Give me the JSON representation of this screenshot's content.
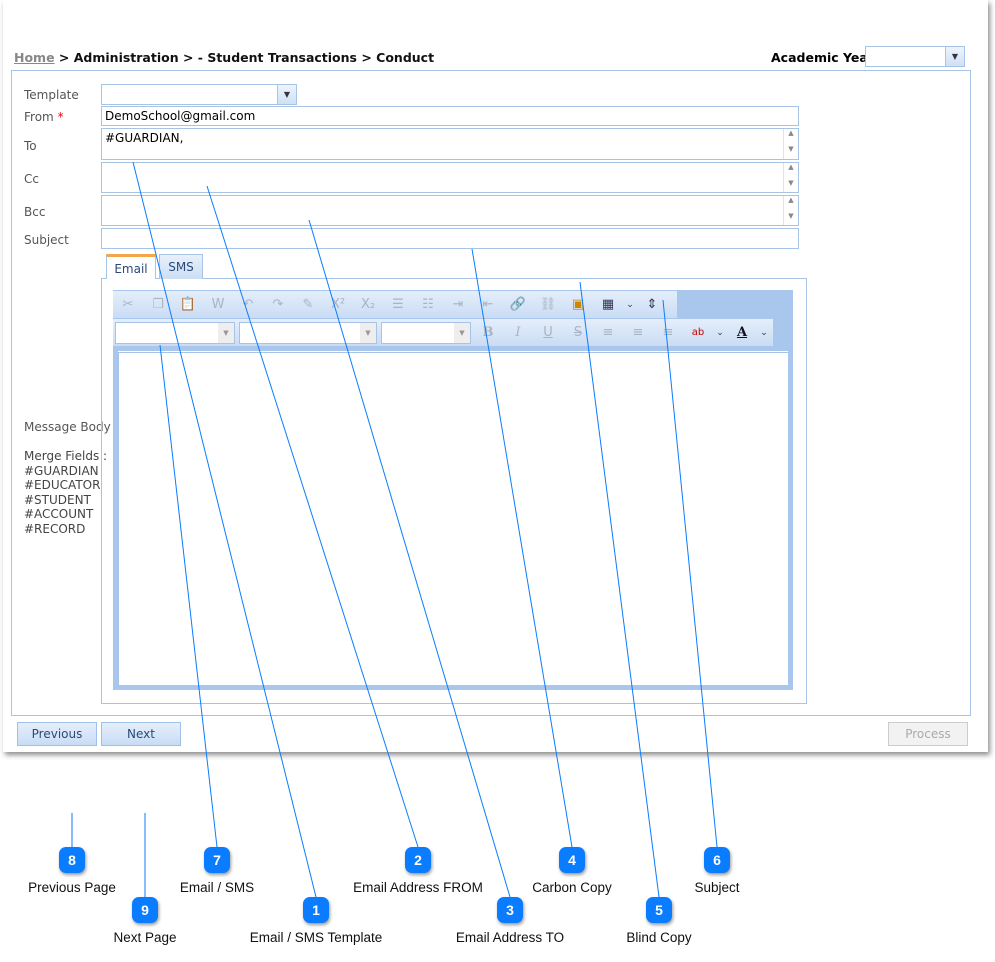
{
  "breadcrumb": {
    "home": "Home",
    "rest": " > Administration > - Student Transactions > Conduct"
  },
  "academic_year": {
    "label": "Academic Year",
    "value": ""
  },
  "form": {
    "template_label": "Template",
    "template_value": "",
    "from_label": "From",
    "required_mark": "*",
    "from_value": "DemoSchool@gmail.com",
    "to_label": "To",
    "to_value": "#GUARDIAN,",
    "cc_label": "Cc",
    "cc_value": "",
    "bcc_label": "Bcc",
    "bcc_value": "",
    "subject_label": "Subject",
    "subject_value": "",
    "message_body_label": "Message Body",
    "merge_fields_label": "Merge Fields :",
    "merge_fields": [
      "#GUARDIAN",
      "#EDUCATOR",
      "#STUDENT",
      "#ACCOUNT",
      "#RECORD"
    ]
  },
  "tabs": [
    {
      "label": "Email",
      "active": true
    },
    {
      "label": "SMS",
      "active": false
    }
  ],
  "toolbar": {
    "font_color_glyph": "A",
    "highlight_glyph": "ab",
    "bold": "B",
    "italic": "I",
    "underline": "U",
    "strike": "S",
    "sup": "X²",
    "sub": "X₂"
  },
  "buttons": {
    "previous": "Previous",
    "next": "Next",
    "process": "Process"
  },
  "callouts": [
    {
      "n": "1",
      "label": "Email / SMS Template"
    },
    {
      "n": "2",
      "label": "Email Address FROM"
    },
    {
      "n": "3",
      "label": "Email Address TO"
    },
    {
      "n": "4",
      "label": "Carbon Copy"
    },
    {
      "n": "5",
      "label": "Blind Copy"
    },
    {
      "n": "6",
      "label": "Subject"
    },
    {
      "n": "7",
      "label": "Email / SMS"
    },
    {
      "n": "8",
      "label": "Previous Page"
    },
    {
      "n": "9",
      "label": "Next Page"
    }
  ],
  "colors": {
    "callout": "#0a7cff",
    "accent_border": "#a7c4e6",
    "tab_active": "#f4a64a"
  }
}
